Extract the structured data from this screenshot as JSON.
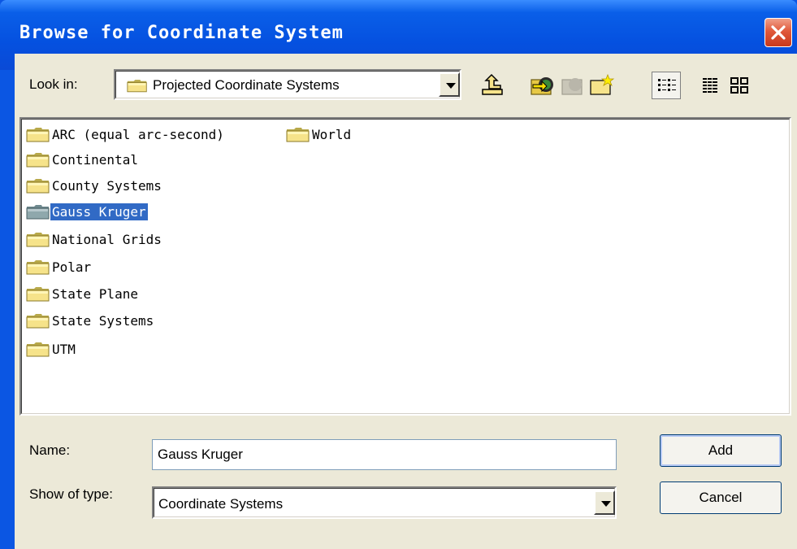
{
  "window": {
    "title": "Browse for Coordinate System"
  },
  "toolbar": {
    "look_in_label": "Look in:",
    "look_in_value": "Projected Coordinate Systems"
  },
  "icons": [
    "folder-icon",
    "up-one-level-icon",
    "connect-folder-icon",
    "disconnect-folder-icon",
    "new-folder-icon",
    "list-view-icon",
    "details-view-icon",
    "thumbnails-view-icon",
    "close-icon",
    "chevron-down-icon"
  ],
  "files": [
    {
      "name": "ARC (equal arc-second)",
      "selected": false
    },
    {
      "name": "World",
      "selected": false
    },
    {
      "name": "Continental",
      "selected": false
    },
    {
      "name": "County Systems",
      "selected": false
    },
    {
      "name": "Gauss Kruger",
      "selected": true
    },
    {
      "name": "National Grids",
      "selected": false
    },
    {
      "name": "Polar",
      "selected": false
    },
    {
      "name": "State Plane",
      "selected": false
    },
    {
      "name": "State Systems",
      "selected": false
    },
    {
      "name": "UTM",
      "selected": false
    }
  ],
  "form": {
    "name_label": "Name:",
    "name_value": "Gauss Kruger",
    "type_label": "Show of type:",
    "type_value": "Coordinate Systems"
  },
  "buttons": {
    "add": "Add",
    "cancel": "Cancel"
  },
  "colors": {
    "title_bar": "#0551e0",
    "selection": "#316ac5",
    "dialog_bg": "#ece9d8",
    "close": "#e0593b"
  }
}
